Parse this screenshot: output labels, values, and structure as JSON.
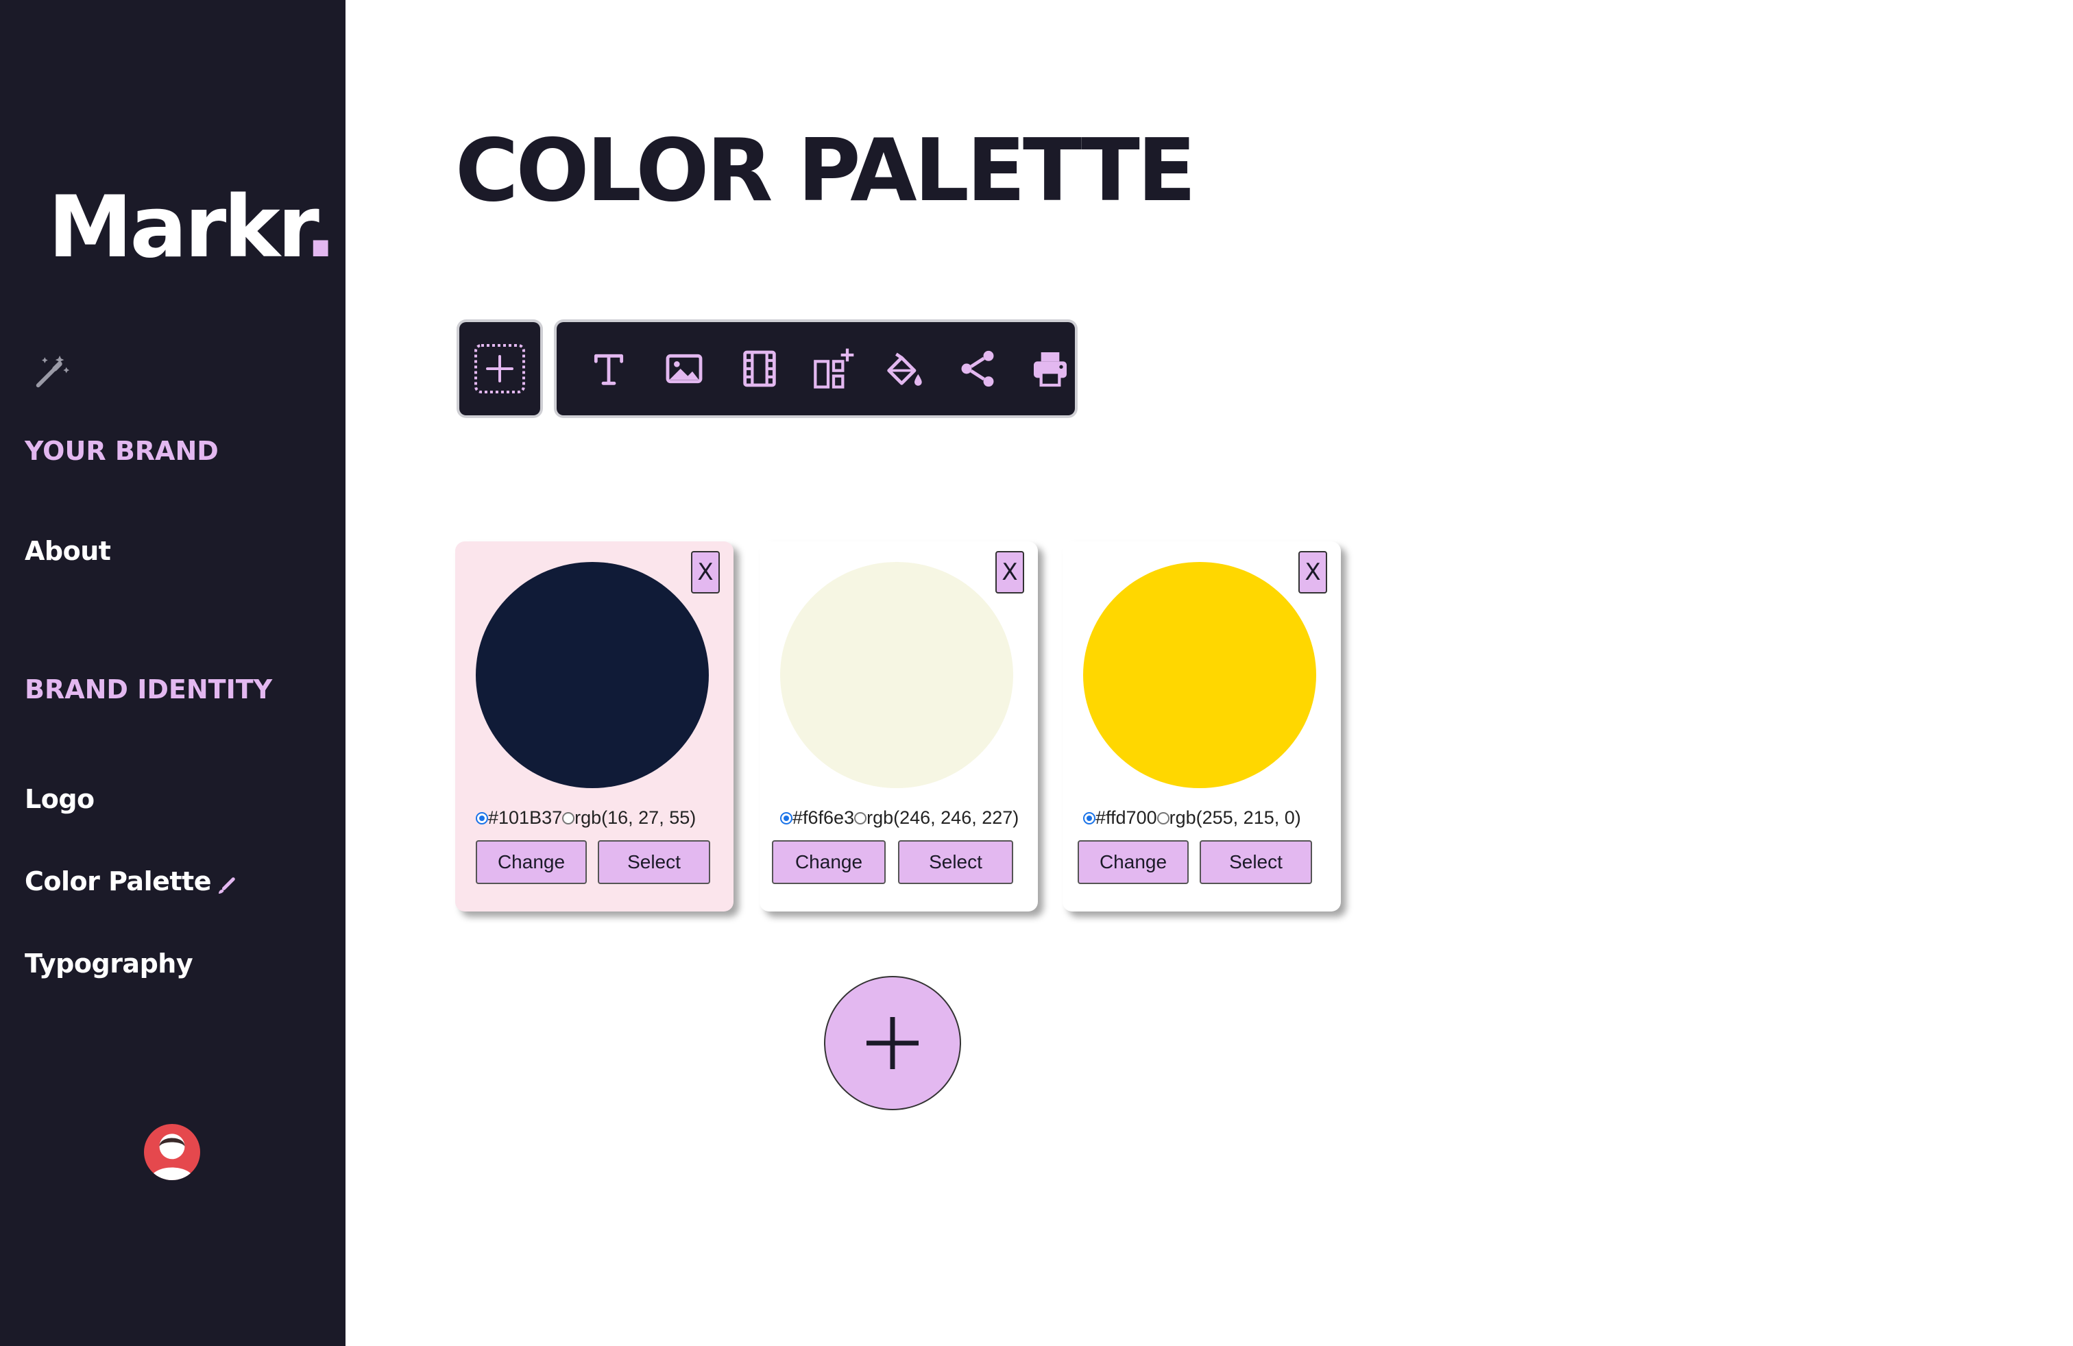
{
  "sidebar": {
    "brand_name": "Markr",
    "brand_dot": ".",
    "magic_icon": "magic-wand-icon",
    "section_your_brand": "YOUR BRAND",
    "item_about": "About",
    "section_brand_identity": "BRAND IDENTITY",
    "item_logo": "Logo",
    "item_color_palette": "Color Palette",
    "item_typography": "Typography",
    "avatar_icon": "user-avatar-icon"
  },
  "main": {
    "title": "COLOR PALETTE"
  },
  "toolbar": {
    "add_block_icon": "add-block-icon",
    "tools": [
      "text-icon",
      "image-icon",
      "video-icon",
      "add-layout-icon",
      "paint-bucket-icon",
      "share-icon",
      "print-icon"
    ]
  },
  "palette": [
    {
      "hex": "#101B37",
      "rgb": "rgb(16, 27, 55)",
      "swatch": "#101b37",
      "selected": true,
      "close": "X",
      "change": "Change",
      "select": "Select"
    },
    {
      "hex": "#f6f6e3",
      "rgb": "rgb(246, 246, 227)",
      "swatch": "#f6f6e3",
      "selected": false,
      "close": "X",
      "change": "Change",
      "select": "Select"
    },
    {
      "hex": "#ffd700",
      "rgb": "rgb(255, 215, 0)",
      "swatch": "#ffd700",
      "selected": false,
      "close": "X",
      "change": "Change",
      "select": "Select"
    }
  ],
  "colors": {
    "sidebar_bg": "#1b1a28",
    "accent": "#e3b8f0",
    "selected_card_bg": "#fbe5ec",
    "avatar_bg": "#e5484d"
  }
}
